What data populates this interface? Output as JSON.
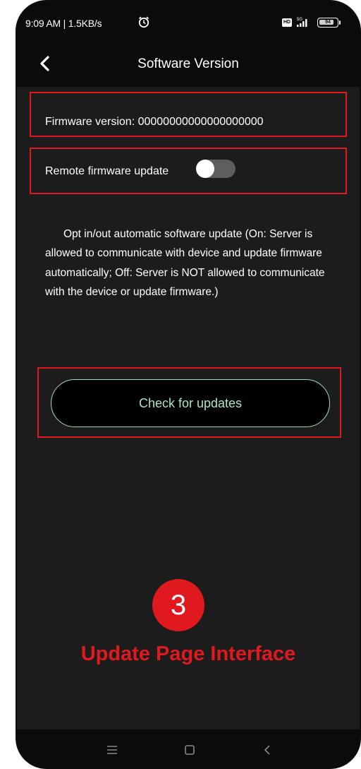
{
  "status_bar": {
    "time_and_speed": "9:09 AM | 1.5KB/s",
    "hd_label": "HD",
    "battery_level": "94",
    "icons": [
      "alarm-icon",
      "hd-icon",
      "signal-5g-icon",
      "battery-icon"
    ]
  },
  "header": {
    "title": "Software Version",
    "back_icon": "chevron-left-icon"
  },
  "firmware": {
    "label": "Firmware version: 00000000000000000000"
  },
  "remote_update": {
    "label": "Remote firmware update",
    "enabled": false
  },
  "description": "Opt in/out automatic software update (On: Server is allowed to communicate with device and update firmware automatically; Off: Server is NOT allowed to communicate with the device or update firmware.)",
  "check_button": {
    "label": "Check for updates"
  },
  "annotation": {
    "step_number": "3",
    "caption": "Update Page Interface",
    "color": "#e0191f"
  },
  "nav_bar": {
    "icons": [
      "menu-icon",
      "home-icon",
      "back-icon"
    ]
  },
  "colors": {
    "background": "#1c1c1c",
    "header": "#0b0b0b",
    "accent_green": "#a9e6c1",
    "highlight_red": "#e0191f"
  }
}
